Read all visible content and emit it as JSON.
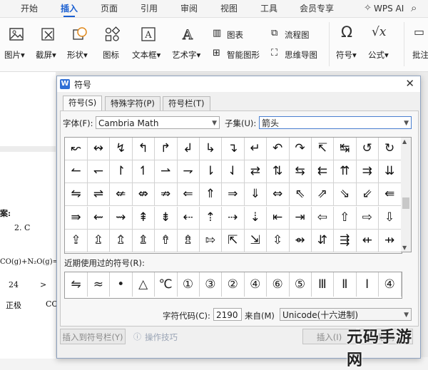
{
  "menubar": {
    "tabs": [
      "开始",
      "插入",
      "页面",
      "引用",
      "审阅",
      "视图",
      "工具",
      "会员专享"
    ],
    "wps_ai": "WPS AI"
  },
  "ribbon": {
    "picture": "图片",
    "screenshot": "截屏",
    "shape": "形状",
    "icon": "图标",
    "textbox": "文本框",
    "wordart": "艺术字",
    "chart": "图表",
    "smartart": "智能图形",
    "flowchart": "流程图",
    "mindmap": "思维导图",
    "symbol": "符号",
    "formula": "公式",
    "annotation": "批注"
  },
  "document": {
    "lines": [
      "案:",
      "2. C",
      "CO(g)+N₂O(g)=",
      "24",
      ">",
      "正极",
      "CO"
    ]
  },
  "dialog": {
    "app_badge": "W",
    "title": "符号",
    "tabs": [
      "符号(S)",
      "特殊字符(P)",
      "符号栏(T)"
    ],
    "font_label": "字体(F):",
    "font_value": "Cambria Math",
    "subset_label": "子集(U):",
    "subset_value": "箭头",
    "symbols": [
      [
        "↜",
        "↭",
        "↯",
        "↰",
        "↱",
        "↲",
        "↳",
        "↴",
        "↵",
        "↶",
        "↷",
        "↸",
        "↹",
        "↺",
        "↻"
      ],
      [
        "↼",
        "↽",
        "↾",
        "↿",
        "⇀",
        "⇁",
        "⇂",
        "⇃",
        "⇄",
        "⇅",
        "⇆",
        "⇇",
        "⇈",
        "⇉",
        "⇊"
      ],
      [
        "⇋",
        "⇌",
        "⇍",
        "⇎",
        "⇏",
        "⇐",
        "⇑",
        "⇒",
        "⇓",
        "⇔",
        "⇖",
        "⇗",
        "⇘",
        "⇙",
        "⇚"
      ],
      [
        "⇛",
        "⇜",
        "⇝",
        "⇞",
        "⇟",
        "⇠",
        "⇡",
        "⇢",
        "⇣",
        "⇤",
        "⇥",
        "⇦",
        "⇧",
        "⇨",
        "⇩"
      ],
      [
        "⇪",
        "⇫",
        "⇬",
        "⇭",
        "⇮",
        "⇯",
        "⇰",
        "⇱",
        "⇲",
        "⇳",
        "⇴",
        "⇵",
        "⇶",
        "⇷",
        "⇸"
      ]
    ],
    "recent_label": "近期使用过的符号(R):",
    "recent": [
      "⇋",
      "≈",
      "•",
      "△",
      "℃",
      "①",
      "③",
      "②",
      "④",
      "⑥",
      "⑤",
      "Ⅲ",
      "Ⅱ",
      "Ⅰ",
      "④"
    ],
    "char_code_label": "字符代码(C):",
    "char_code_value": "2190",
    "from_label": "来自(M)",
    "from_value": "Unicode(十六进制)",
    "insert_to_bar": "插入到符号栏(Y)",
    "tips": "操作技巧",
    "insert": "插入(I)",
    "cancel": "取消"
  },
  "watermark": "元码手游网"
}
